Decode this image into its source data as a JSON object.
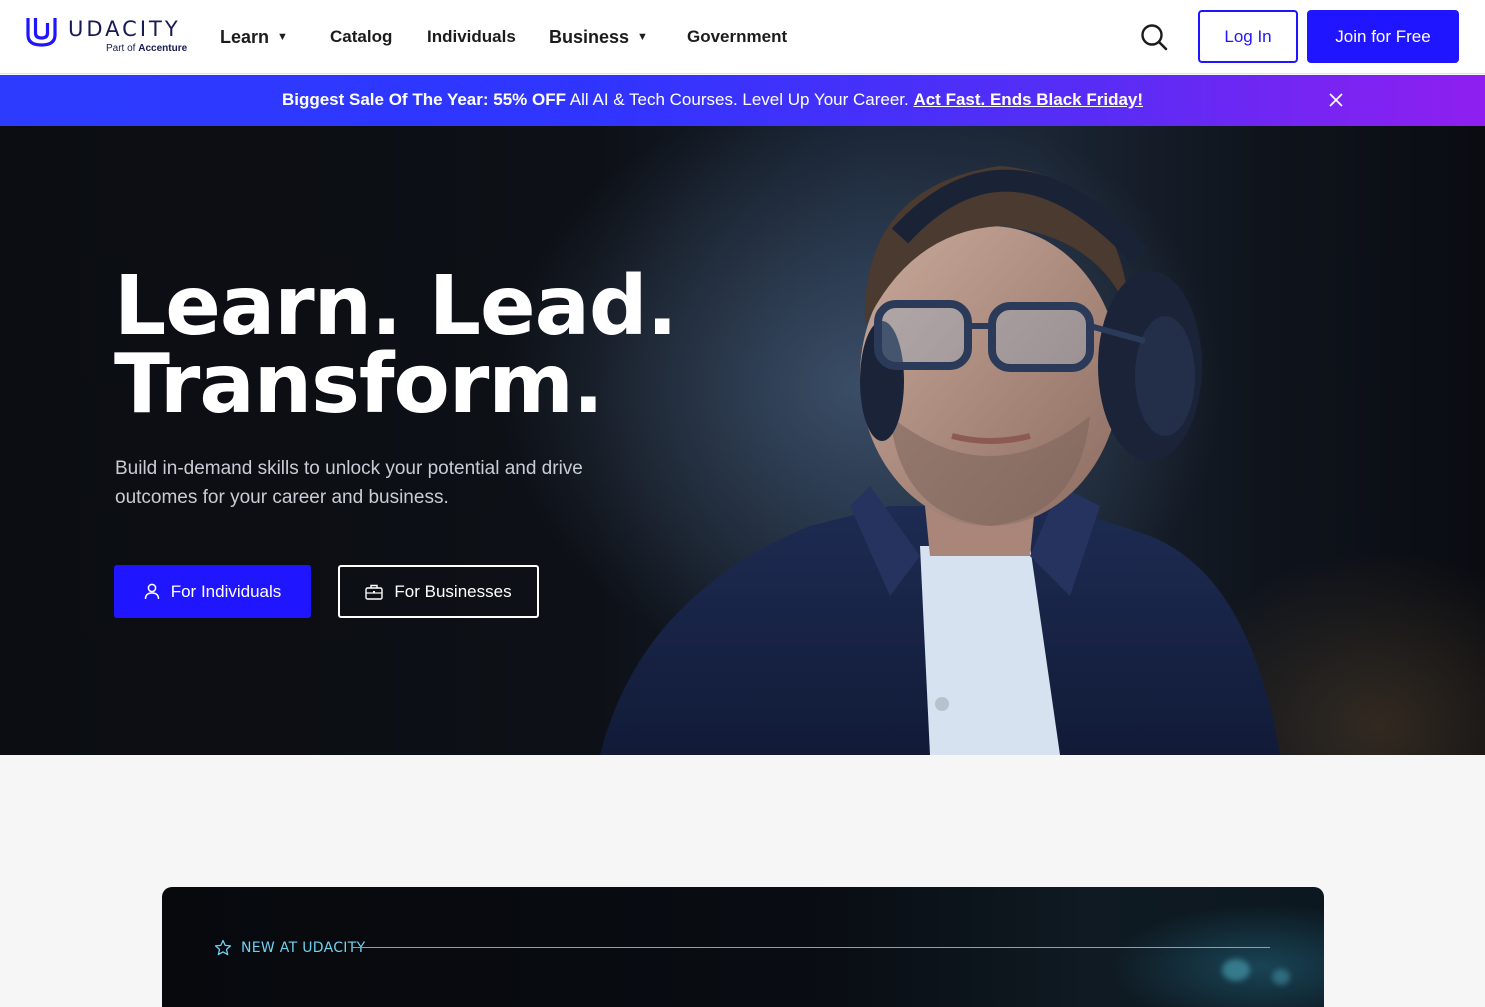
{
  "header": {
    "logo": {
      "wordmark": "UDACITY",
      "sub_prefix": "Part of",
      "sub_brand": "Accenture"
    },
    "nav": [
      {
        "label": "Learn",
        "has_dropdown": true
      },
      {
        "label": "Catalog",
        "has_dropdown": false
      },
      {
        "label": "Individuals",
        "has_dropdown": false
      },
      {
        "label": "Business",
        "has_dropdown": true
      },
      {
        "label": "Government",
        "has_dropdown": false
      }
    ],
    "search_icon": "search-icon",
    "login_label": "Log In",
    "join_label": "Join for Free"
  },
  "promo": {
    "strong_text": "Biggest Sale Of The Year: 55% OFF",
    "body_text": " All AI & Tech Courses. Level Up Your Career. ",
    "link_text": "Act Fast. Ends Black Friday!",
    "close_icon": "close-icon"
  },
  "hero": {
    "title_line1": "Learn. Lead.",
    "title_line2": "Transform.",
    "subtitle": "Build in-demand skills to unlock your potential and drive outcomes for your career and business.",
    "primary_button": "For Individuals",
    "primary_icon": "user-icon",
    "secondary_button": "For Businesses",
    "secondary_icon": "briefcase-icon"
  },
  "new_section": {
    "label": "NEW AT UDACITY",
    "icon": "star-icon"
  },
  "colors": {
    "brand_blue": "#2015ff",
    "promo_start": "#2d3bff",
    "promo_end": "#8f1ff0",
    "accent_cyan": "#6fd0ef"
  }
}
